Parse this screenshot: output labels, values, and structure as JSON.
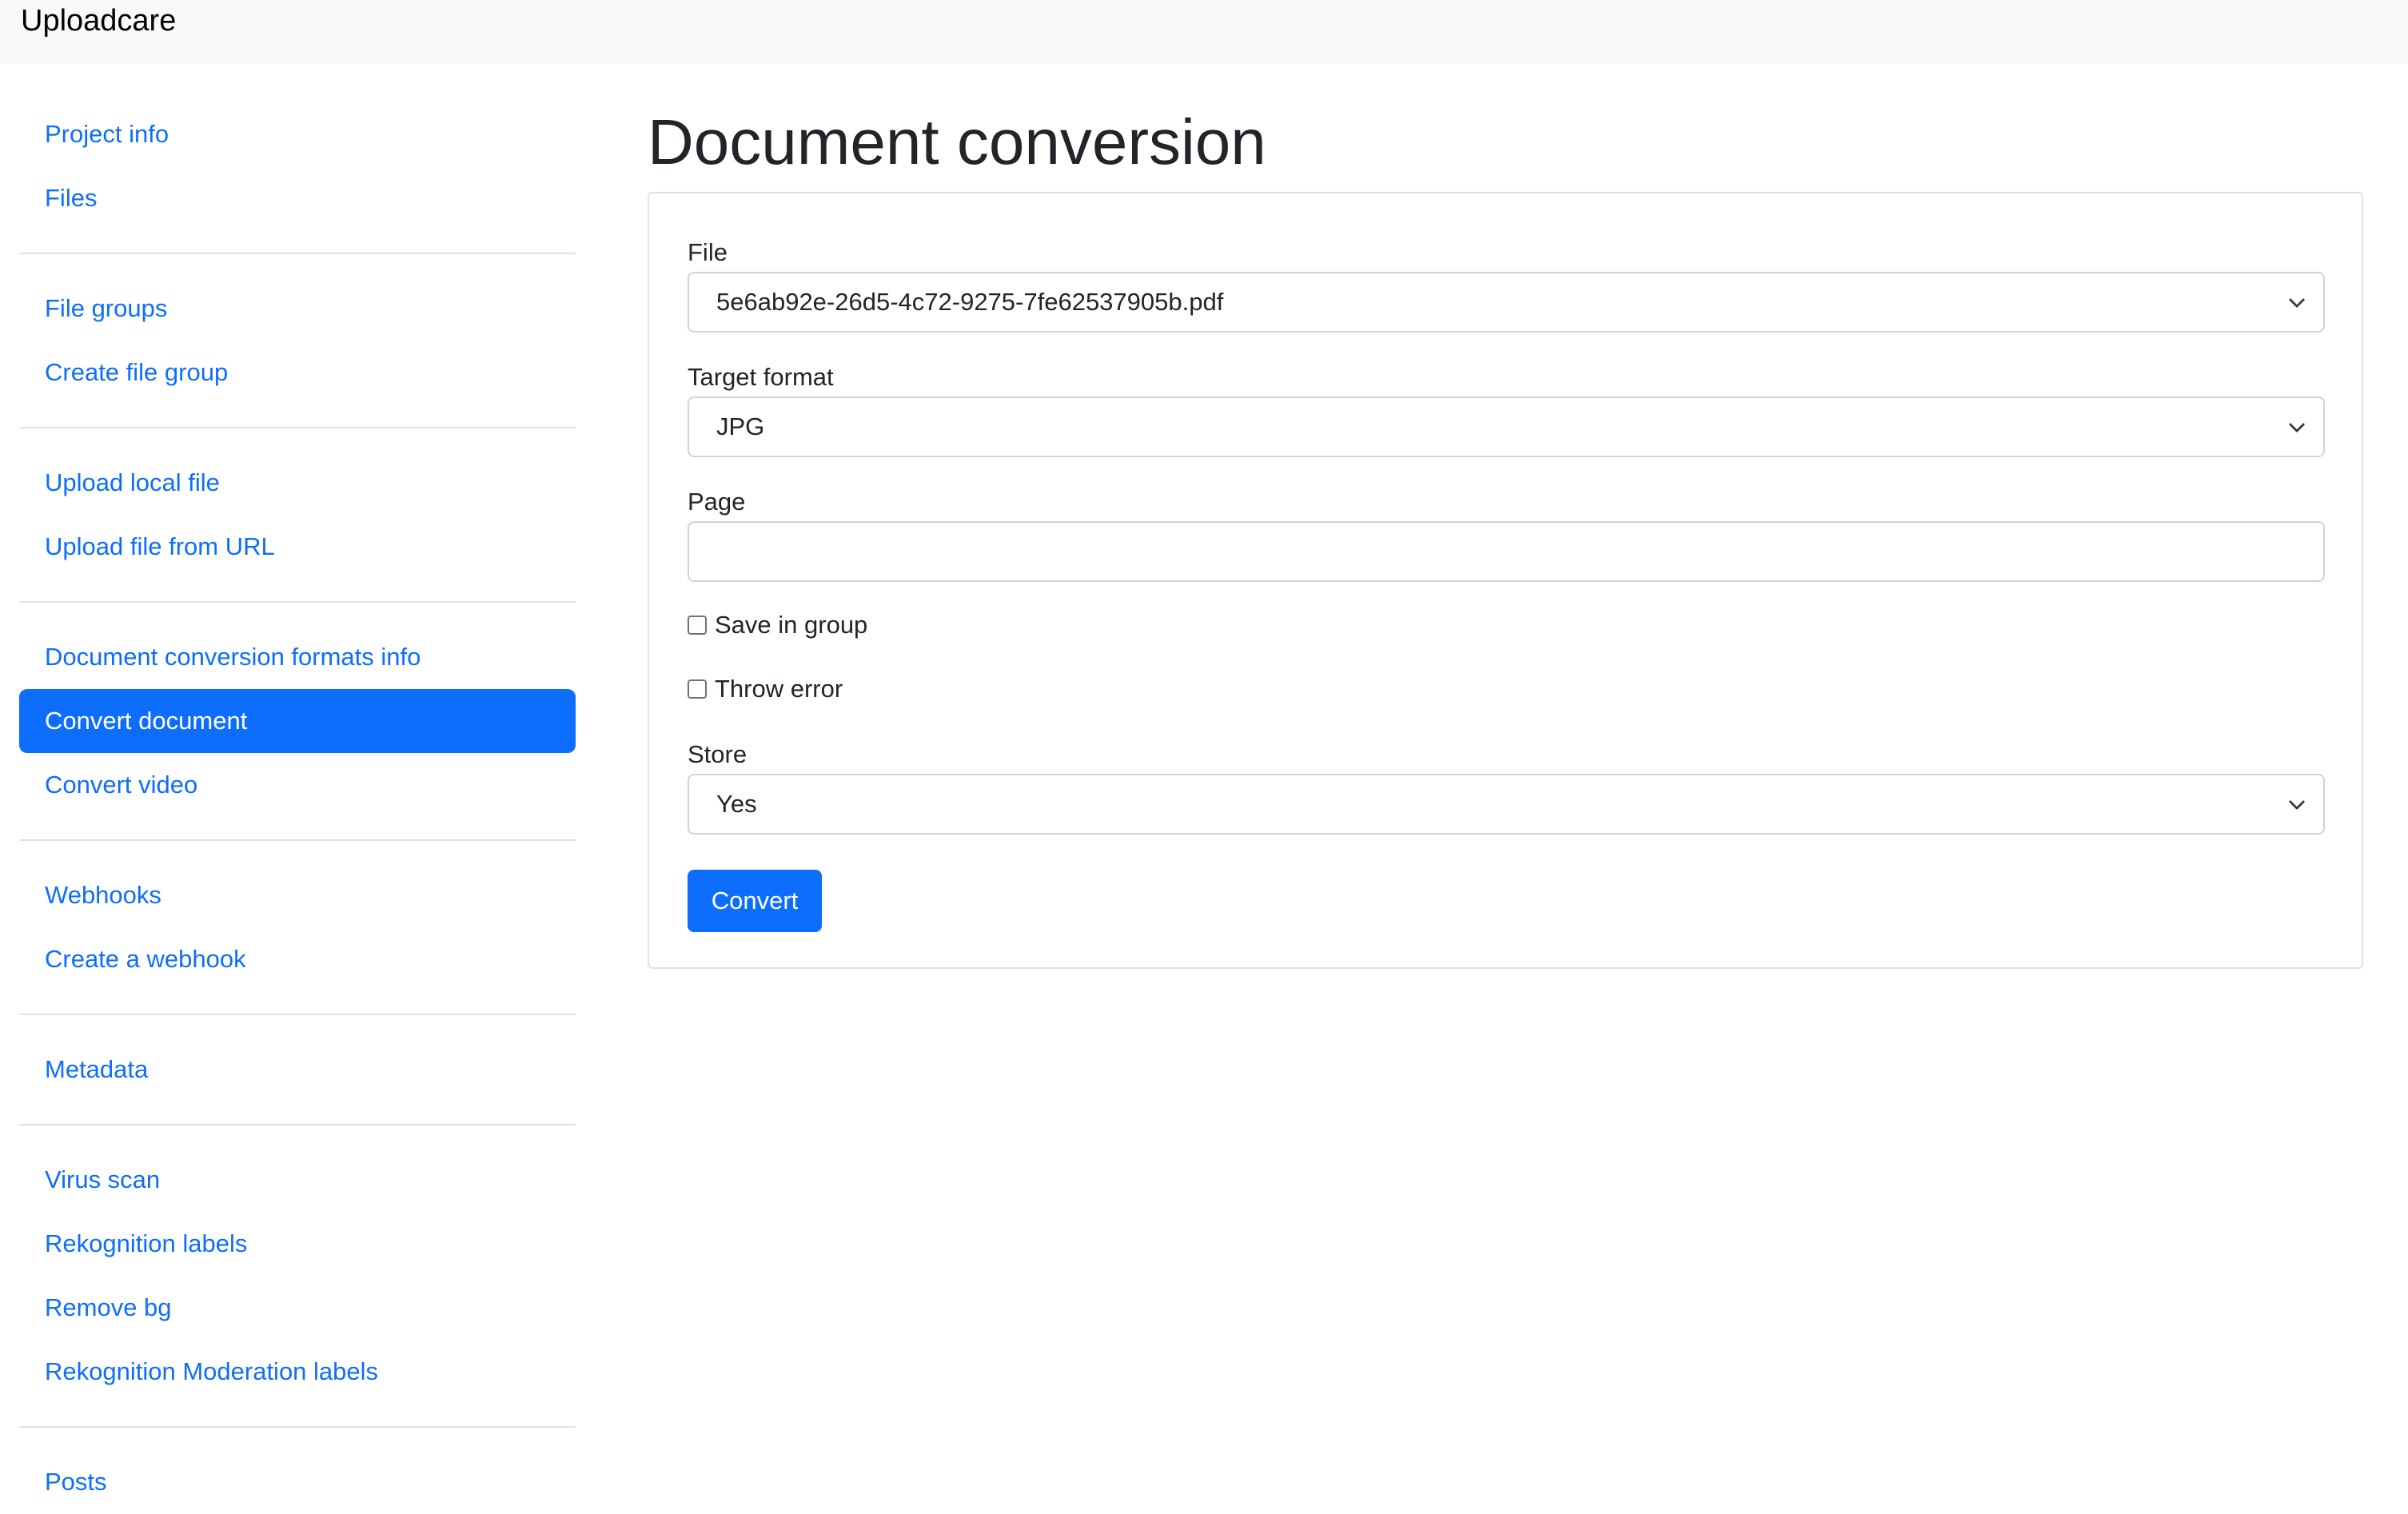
{
  "app": {
    "brand": "Uploadcare"
  },
  "sidebar": {
    "groups": [
      [
        {
          "label": "Project info"
        },
        {
          "label": "Files"
        }
      ],
      [
        {
          "label": "File groups"
        },
        {
          "label": "Create file group"
        }
      ],
      [
        {
          "label": "Upload local file"
        },
        {
          "label": "Upload file from URL"
        }
      ],
      [
        {
          "label": "Document conversion formats info"
        },
        {
          "label": "Convert document",
          "active": true
        },
        {
          "label": "Convert video"
        }
      ],
      [
        {
          "label": "Webhooks"
        },
        {
          "label": "Create a webhook"
        }
      ],
      [
        {
          "label": "Metadata"
        }
      ],
      [
        {
          "label": "Virus scan"
        },
        {
          "label": "Rekognition labels"
        },
        {
          "label": "Remove bg"
        },
        {
          "label": "Rekognition Moderation labels"
        }
      ],
      [
        {
          "label": "Posts"
        }
      ]
    ]
  },
  "main": {
    "title": "Document conversion",
    "form": {
      "file": {
        "label": "File",
        "value": "5e6ab92e-26d5-4c72-9275-7fe62537905b.pdf"
      },
      "target_format": {
        "label": "Target format",
        "value": "JPG"
      },
      "page": {
        "label": "Page",
        "value": "",
        "placeholder": ""
      },
      "save_in_group": {
        "label": "Save in group",
        "checked": false
      },
      "throw_error": {
        "label": "Throw error",
        "checked": false
      },
      "store": {
        "label": "Store",
        "value": "Yes"
      },
      "submit_label": "Convert"
    }
  },
  "colors": {
    "primary": "#0d6efd",
    "navbar_bg": "#f8f9fa",
    "border": "#dee2e6",
    "text": "#212529"
  },
  "icons": {
    "select_arrow": "chevron-down-icon"
  }
}
